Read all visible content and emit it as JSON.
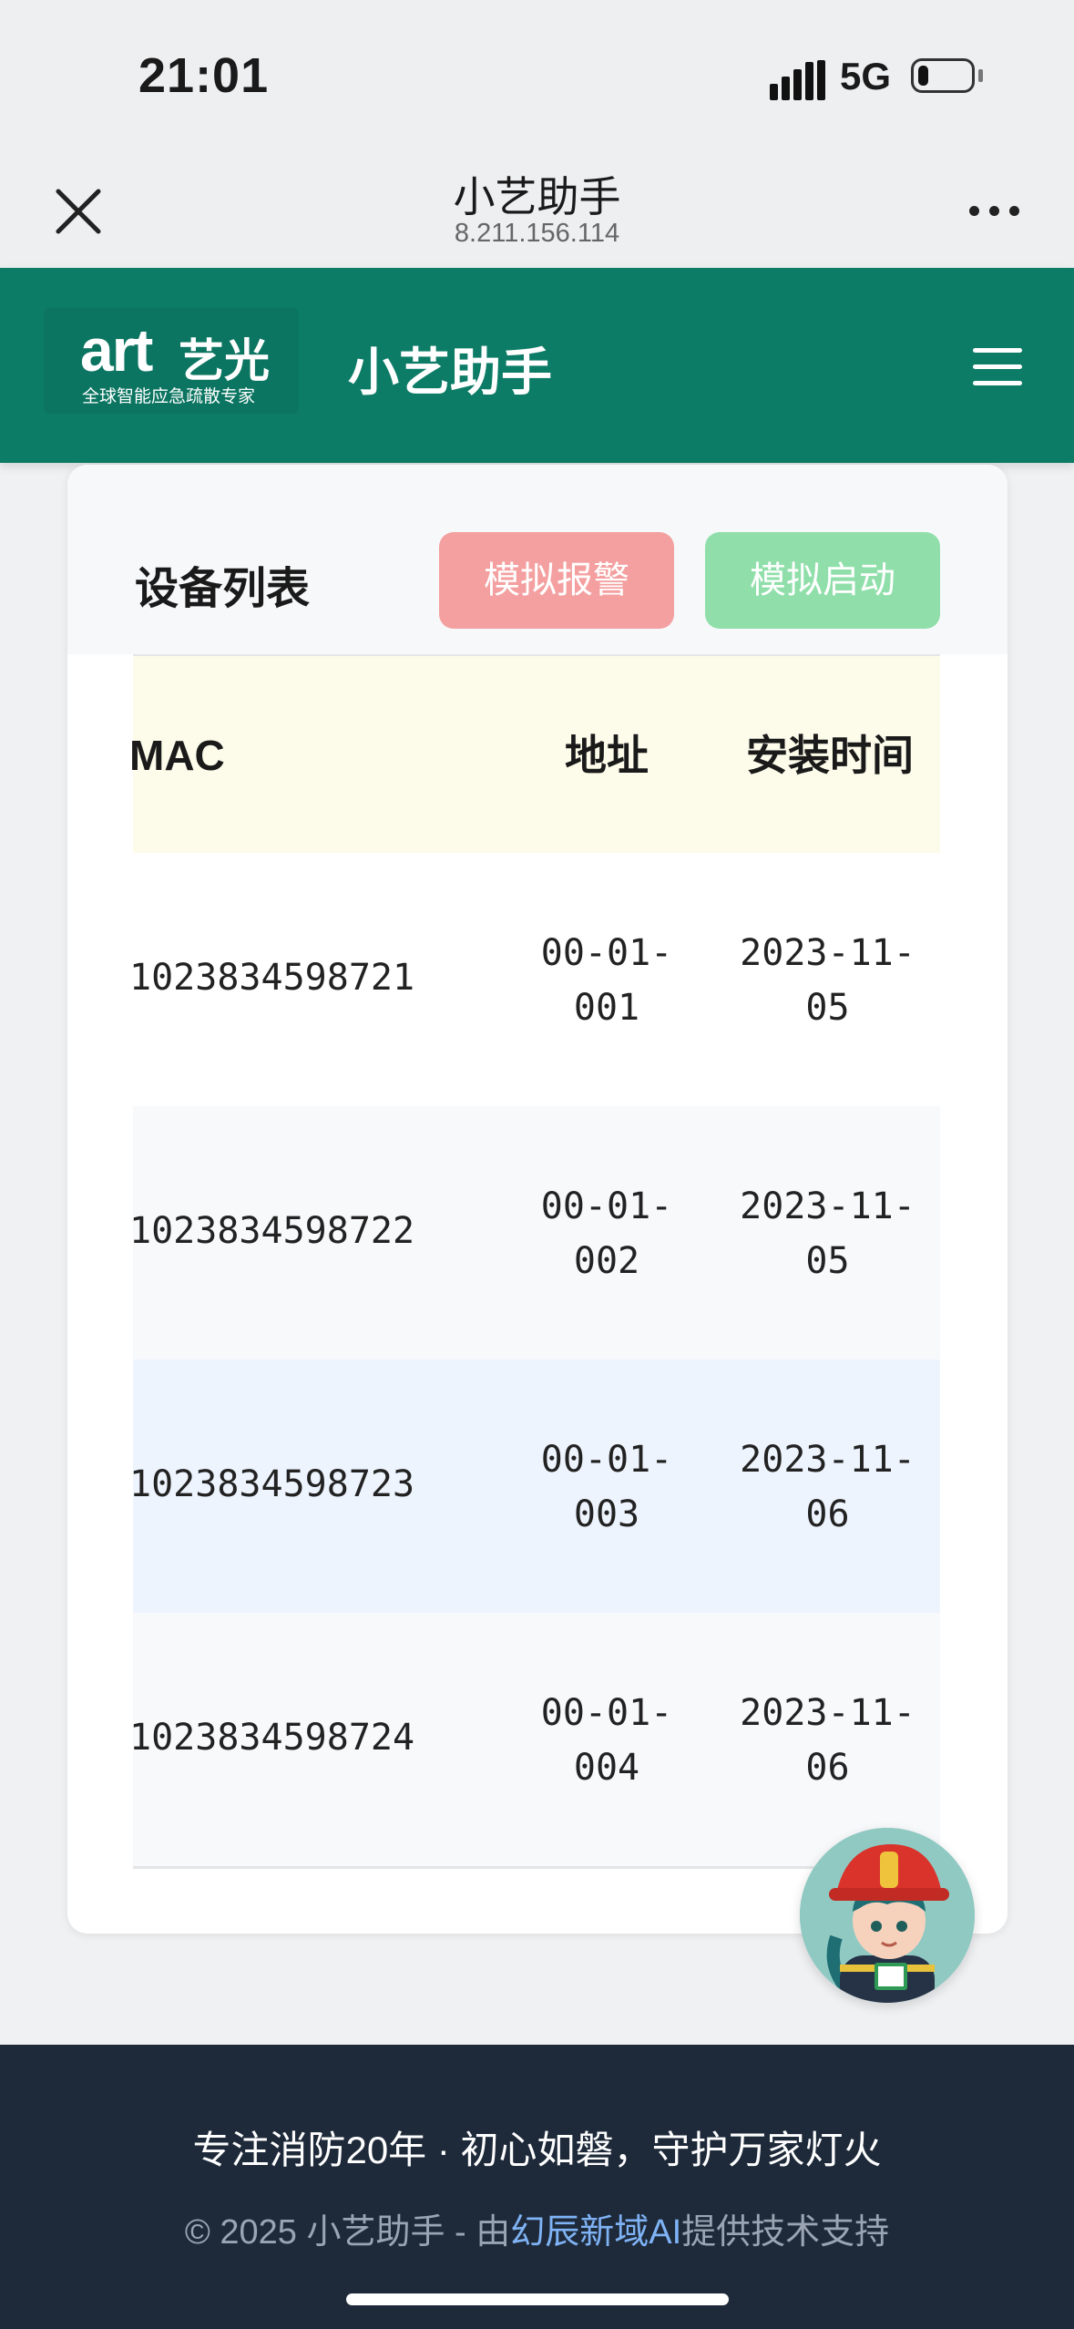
{
  "status_bar": {
    "time": "21:01",
    "network": "5G",
    "battery_level": 0.2
  },
  "browser": {
    "title": "小艺助手",
    "url": "8.211.156.114"
  },
  "header": {
    "logo_en": "art",
    "logo_cn": "艺光",
    "logo_tagline": "全球智能应急疏散专家",
    "app_title": "小艺助手"
  },
  "card": {
    "title": "设备列表",
    "buttons": {
      "alarm": "模拟报警",
      "start": "模拟启动"
    },
    "columns": {
      "mac": "MAC",
      "address": "地址",
      "install_time": "安装时间"
    },
    "rows": [
      {
        "mac": "1023834598721",
        "addr1": "00-01-",
        "addr2": "001",
        "time1": "2023-11-",
        "time2": "05",
        "bg": "#ffffff"
      },
      {
        "mac": "1023834598722",
        "addr1": "00-01-",
        "addr2": "002",
        "time1": "2023-11-",
        "time2": "05",
        "bg": "#f8f9fb"
      },
      {
        "mac": "1023834598723",
        "addr1": "00-01-",
        "addr2": "003",
        "time1": "2023-11-",
        "time2": "06",
        "bg": "#eef4fe"
      },
      {
        "mac": "1023834598724",
        "addr1": "00-01-",
        "addr2": "004",
        "time1": "2023-11-",
        "time2": "06",
        "bg": "#f8f9fb"
      }
    ]
  },
  "footer": {
    "slogan": "专注消防20年 · 初心如磐，守护万家灯火",
    "copyright_prefix": "© 2025 小艺助手 - 由",
    "copyright_link": "幻辰新域AI",
    "copyright_suffix": "提供技术支持"
  },
  "colors": {
    "brand": "#0d7c67",
    "alarm": "#f4a0a0",
    "start": "#90dfaa",
    "footer": "#1e2a3a"
  }
}
